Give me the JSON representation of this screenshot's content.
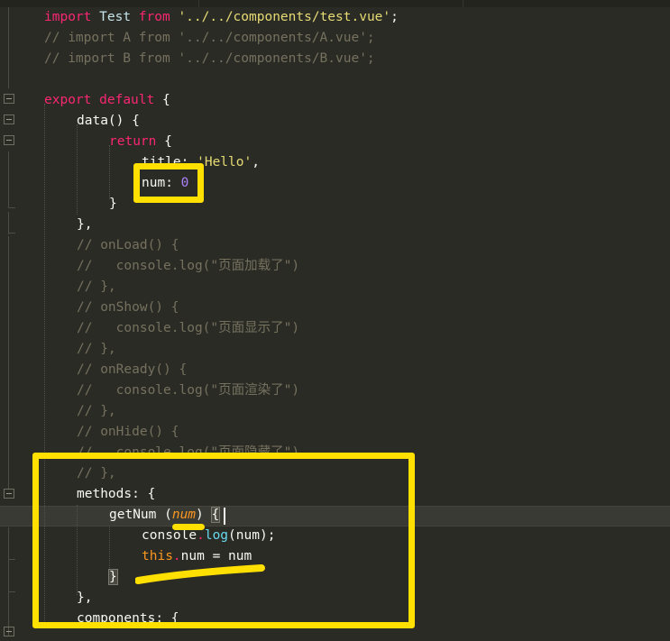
{
  "editor": {
    "theme": "monokai-dark",
    "background": "#2b2b26",
    "current_line_background": "#3a3a34",
    "language": "vue-javascript",
    "font_size_px": 14.5,
    "line_height_px": 23
  },
  "annotations": {
    "color": "#ffe000",
    "items": [
      {
        "name": "num-property-box",
        "shape": "rectangle",
        "target": "num: 0"
      },
      {
        "name": "methods-block-box",
        "shape": "rectangle",
        "target": "methods: { getNum (num) { ... } }"
      },
      {
        "name": "num-param-underline",
        "shape": "underline",
        "target": "num"
      },
      {
        "name": "this-num-assign-underline",
        "shape": "underline",
        "target": "this.num = num"
      }
    ]
  },
  "code_lines": [
    {
      "n": 1,
      "indent": 0,
      "tokens": [
        {
          "t": "import",
          "c": "kw"
        },
        {
          "t": " ",
          "c": "punc"
        },
        {
          "t": "Test",
          "c": "cls"
        },
        {
          "t": " ",
          "c": "punc"
        },
        {
          "t": "from",
          "c": "kw"
        },
        {
          "t": " ",
          "c": "punc"
        },
        {
          "t": "'../../components/test.vue'",
          "c": "str"
        },
        {
          "t": ";",
          "c": "punc"
        }
      ]
    },
    {
      "n": 2,
      "indent": 0,
      "tokens": [
        {
          "t": "// import A from '../../components/A.vue';",
          "c": "cmt"
        }
      ]
    },
    {
      "n": 3,
      "indent": 0,
      "tokens": [
        {
          "t": "// import B from '../../components/B.vue';",
          "c": "cmt"
        }
      ]
    },
    {
      "n": 4,
      "indent": 0,
      "tokens": []
    },
    {
      "n": 5,
      "indent": 0,
      "tokens": [
        {
          "t": "export",
          "c": "kw"
        },
        {
          "t": " ",
          "c": "punc"
        },
        {
          "t": "default",
          "c": "kw"
        },
        {
          "t": " {",
          "c": "punc"
        }
      ]
    },
    {
      "n": 6,
      "indent": 1,
      "tokens": [
        {
          "t": "data",
          "c": "white"
        },
        {
          "t": "() {",
          "c": "punc"
        }
      ]
    },
    {
      "n": 7,
      "indent": 2,
      "tokens": [
        {
          "t": "return",
          "c": "kw"
        },
        {
          "t": " {",
          "c": "punc"
        }
      ]
    },
    {
      "n": 8,
      "indent": 3,
      "tokens": [
        {
          "t": "title: ",
          "c": "white"
        },
        {
          "t": "'Hello'",
          "c": "str"
        },
        {
          "t": ",",
          "c": "punc"
        }
      ]
    },
    {
      "n": 9,
      "indent": 3,
      "tokens": [
        {
          "t": "num: ",
          "c": "white"
        },
        {
          "t": "0",
          "c": "num"
        }
      ]
    },
    {
      "n": 10,
      "indent": 2,
      "tokens": [
        {
          "t": "}",
          "c": "punc"
        }
      ]
    },
    {
      "n": 11,
      "indent": 1,
      "tokens": [
        {
          "t": "},",
          "c": "punc"
        }
      ]
    },
    {
      "n": 12,
      "indent": 1,
      "tokens": [
        {
          "t": "// onLoad() {",
          "c": "cmt"
        }
      ]
    },
    {
      "n": 13,
      "indent": 1,
      "tokens": [
        {
          "t": "//   console.log(\"页面加载了\")",
          "c": "cmt"
        }
      ]
    },
    {
      "n": 14,
      "indent": 1,
      "tokens": [
        {
          "t": "// },",
          "c": "cmt"
        }
      ]
    },
    {
      "n": 15,
      "indent": 1,
      "tokens": [
        {
          "t": "// onShow() {",
          "c": "cmt"
        }
      ]
    },
    {
      "n": 16,
      "indent": 1,
      "tokens": [
        {
          "t": "//   console.log(\"页面显示了\")",
          "c": "cmt"
        }
      ]
    },
    {
      "n": 17,
      "indent": 1,
      "tokens": [
        {
          "t": "// },",
          "c": "cmt"
        }
      ]
    },
    {
      "n": 18,
      "indent": 1,
      "tokens": [
        {
          "t": "// onReady() {",
          "c": "cmt"
        }
      ]
    },
    {
      "n": 19,
      "indent": 1,
      "tokens": [
        {
          "t": "//   console.log(\"页面渲染了\")",
          "c": "cmt"
        }
      ]
    },
    {
      "n": 20,
      "indent": 1,
      "tokens": [
        {
          "t": "// },",
          "c": "cmt"
        }
      ]
    },
    {
      "n": 21,
      "indent": 1,
      "tokens": [
        {
          "t": "// onHide() {",
          "c": "cmt"
        }
      ]
    },
    {
      "n": 22,
      "indent": 1,
      "tokens": [
        {
          "t": "//   console.log(\"页面隐藏了\")",
          "c": "cmt"
        }
      ]
    },
    {
      "n": 23,
      "indent": 1,
      "tokens": [
        {
          "t": "// },",
          "c": "cmt"
        }
      ]
    },
    {
      "n": 24,
      "indent": 1,
      "tokens": [
        {
          "t": "methods",
          "c": "white"
        },
        {
          "t": ": {",
          "c": "punc"
        }
      ]
    },
    {
      "n": 25,
      "indent": 2,
      "tokens": [
        {
          "t": "getNum ",
          "c": "white"
        },
        {
          "t": "(",
          "c": "punc"
        },
        {
          "t": "num",
          "c": "param"
        },
        {
          "t": ")",
          "c": "punc"
        },
        {
          "t": " ",
          "c": "punc"
        },
        {
          "t": "{",
          "c": "bracket"
        }
      ]
    },
    {
      "n": 26,
      "indent": 3,
      "tokens": [
        {
          "t": "console",
          "c": "white"
        },
        {
          "t": ".",
          "c": "kw"
        },
        {
          "t": "log",
          "c": "meth"
        },
        {
          "t": "(num);",
          "c": "white"
        }
      ]
    },
    {
      "n": 27,
      "indent": 3,
      "tokens": [
        {
          "t": "this",
          "c": "this"
        },
        {
          "t": ".",
          "c": "kw"
        },
        {
          "t": "num = num",
          "c": "white"
        }
      ]
    },
    {
      "n": 28,
      "indent": 2,
      "tokens": [
        {
          "t": "}",
          "c": "bracket"
        }
      ]
    },
    {
      "n": 29,
      "indent": 1,
      "tokens": [
        {
          "t": "},",
          "c": "punc"
        }
      ]
    },
    {
      "n": 30,
      "indent": 1,
      "tokens": [
        {
          "t": "components",
          "c": "white"
        },
        {
          "t": ": {",
          "c": "punc"
        }
      ]
    }
  ]
}
